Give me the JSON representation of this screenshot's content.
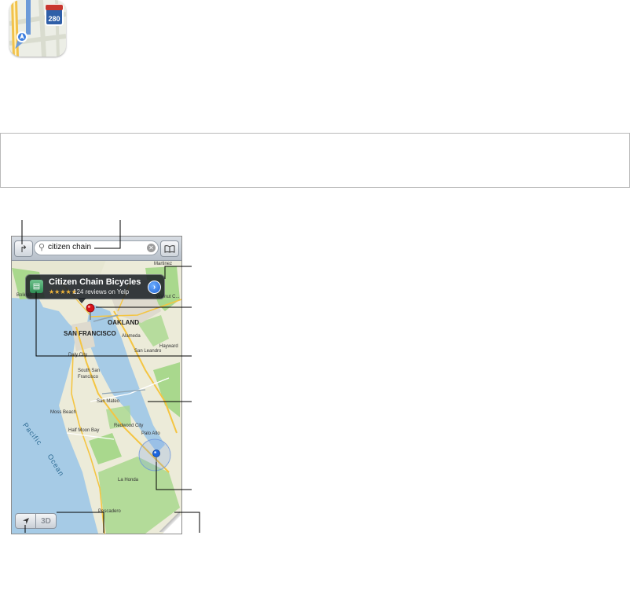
{
  "app": {
    "icon_name": "maps-app-icon",
    "highway_shield": "280"
  },
  "search": {
    "value": "citizen chain"
  },
  "callout": {
    "title": "Citizen Chain Bicycles",
    "stars": "★★★★★",
    "reviews": "124 reviews on Yelp"
  },
  "bottom_bar": {
    "threed_label": "3D"
  },
  "map_labels": {
    "martinez": "Martinez",
    "walnut_creek": "Walnut C...",
    "bolinas": "Bolinas",
    "oakland": "OAKLAND",
    "san_francisco": "SAN FRANCISCO",
    "alameda": "Alameda",
    "san_leandro": "San Leandro",
    "hayward": "Hayward",
    "daly_city": "Daly City",
    "south_sf": "South San",
    "francisco": "Francisco",
    "san_mateo": "San Mateo",
    "moss_beach": "Moss Beach",
    "half_moon_bay": "Half Moon Bay",
    "redwood_city": "Redwood City",
    "palo_alto": "Palo Alto",
    "la_honda": "La Honda",
    "pescadero": "Pescadero",
    "pacific": "Pacific",
    "ocean": "Ocean"
  },
  "colors": {
    "water": "#a6cbe6",
    "land": "#ecebd9",
    "park": "#a9d88d",
    "road": "#f4c542",
    "pin_red": "#d8141a",
    "pin_blue": "#1d66e0"
  }
}
